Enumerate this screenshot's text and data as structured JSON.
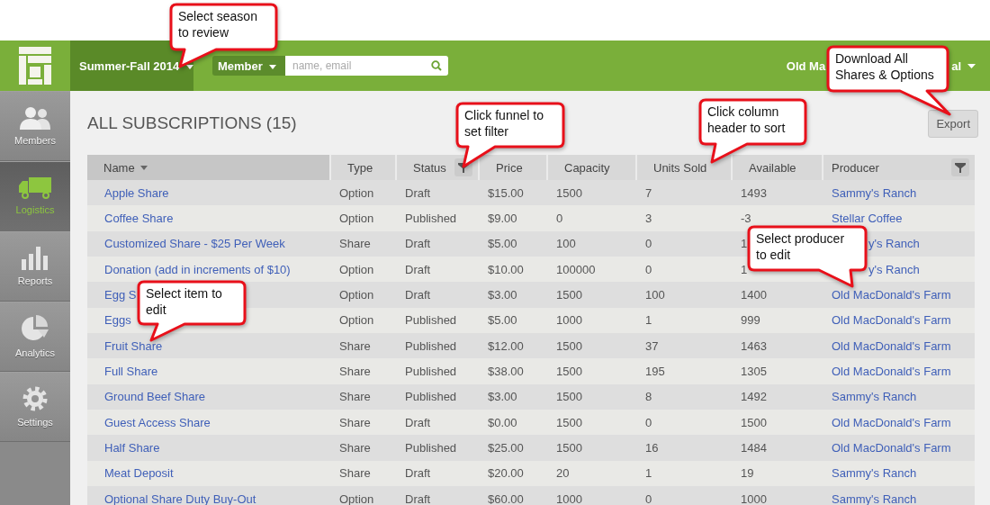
{
  "header": {
    "season": "Summer-Fall 2014",
    "search_scope": "Member",
    "search": {
      "placeholder": "name, email"
    },
    "user": {
      "name_start": "Old Ma",
      "name_end": "al"
    }
  },
  "sidebar": {
    "items": [
      {
        "label": "Members",
        "kind": "members",
        "selected": false
      },
      {
        "label": "Logistics",
        "kind": "logistics",
        "selected": true
      },
      {
        "label": "Reports",
        "kind": "reports",
        "selected": false
      },
      {
        "label": "Analytics",
        "kind": "analytics",
        "selected": false
      },
      {
        "label": "Settings",
        "kind": "settings",
        "selected": false
      }
    ]
  },
  "page_title": "ALL SUBSCRIPTIONS (15)",
  "export_button": "Export",
  "table": {
    "columns": [
      {
        "label": "Name",
        "sorted": true,
        "filter": false
      },
      {
        "label": "Type",
        "sorted": false,
        "filter": false
      },
      {
        "label": "Status",
        "sorted": false,
        "filter": true
      },
      {
        "label": "Price",
        "sorted": false,
        "filter": false
      },
      {
        "label": "Capacity",
        "sorted": false,
        "filter": false
      },
      {
        "label": "Units Sold",
        "sorted": false,
        "filter": false
      },
      {
        "label": "Available",
        "sorted": false,
        "filter": false
      },
      {
        "label": "Producer",
        "sorted": false,
        "filter": true
      }
    ],
    "rows": [
      [
        "Apple Share",
        "Option",
        "Draft",
        "$15.00",
        "1500",
        "7",
        "1493",
        "Sammy's Ranch"
      ],
      [
        "Coffee Share",
        "Option",
        "Published",
        "$9.00",
        "0",
        "3",
        "-3",
        "Stellar Coffee"
      ],
      [
        "Customized Share - $25 Per Week",
        "Share",
        "Draft",
        "$5.00",
        "100",
        "0",
        "1",
        "y's Ranch"
      ],
      [
        "Donation (add in increments of $10)",
        "Option",
        "Draft",
        "$10.00",
        "100000",
        "0",
        "1",
        "y's Ranch"
      ],
      [
        "Egg S",
        "Option",
        "Draft",
        "$3.00",
        "1500",
        "100",
        "1400",
        "Old MacDonald's Farm"
      ],
      [
        "Eggs",
        "Option",
        "Published",
        "$5.00",
        "1000",
        "1",
        "999",
        "Old MacDonald's Farm"
      ],
      [
        "Fruit Share",
        "Share",
        "Published",
        "$12.00",
        "1500",
        "37",
        "1463",
        "Old MacDonald's Farm"
      ],
      [
        "Full Share",
        "Share",
        "Published",
        "$38.00",
        "1500",
        "195",
        "1305",
        "Old MacDonald's Farm"
      ],
      [
        "Ground Beef Share",
        "Share",
        "Published",
        "$3.00",
        "1500",
        "8",
        "1492",
        "Sammy's Ranch"
      ],
      [
        "Guest Access Share",
        "Share",
        "Draft",
        "$0.00",
        "1500",
        "0",
        "1500",
        "Old MacDonald's Farm"
      ],
      [
        "Half Share",
        "Share",
        "Published",
        "$25.00",
        "1500",
        "16",
        "1484",
        "Old MacDonald's Farm"
      ],
      [
        "Meat Deposit",
        "Share",
        "Draft",
        "$20.00",
        "20",
        "1",
        "19",
        "Sammy's Ranch"
      ],
      [
        "Optional Share Duty Buy-Out",
        "Option",
        "Draft",
        "$60.00",
        "1000",
        "0",
        "1000",
        "Sammy's Ranch"
      ]
    ]
  },
  "callouts": [
    {
      "text": "Select season\nto review"
    },
    {
      "text": "Download All\nShares & Options"
    },
    {
      "text": "Click funnel to\nset filter"
    },
    {
      "text": "Click column\nheader to sort"
    },
    {
      "text": "Select producer\nto edit"
    },
    {
      "text": "Select item to\nedit"
    }
  ]
}
